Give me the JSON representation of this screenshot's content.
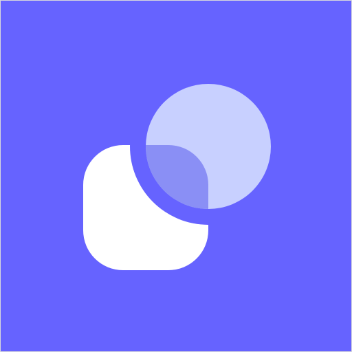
{
  "logo": {
    "icon": "overlapping-rounded-square-and-circle-icon",
    "colors": {
      "background": "#6663FF",
      "square": "#FFFFFF",
      "circle": "#C8D0FF",
      "overlap": "#8A8FF5"
    }
  }
}
